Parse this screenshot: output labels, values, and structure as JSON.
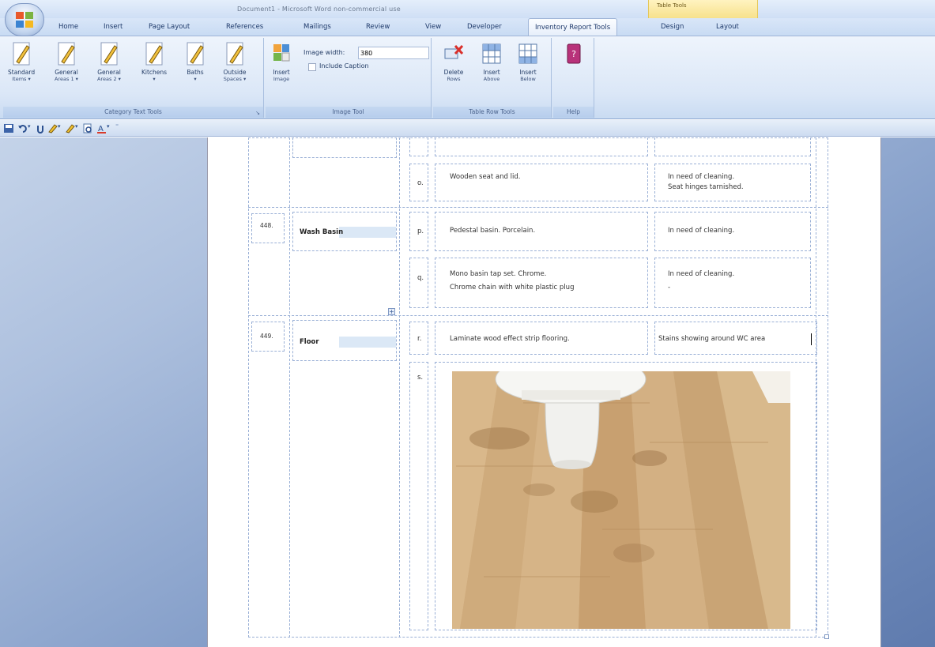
{
  "window": {
    "title": "Document1 - Microsoft Word non-commercial use",
    "context_tab_group": "Table Tools"
  },
  "tabs": [
    {
      "label": "Home"
    },
    {
      "label": "Insert"
    },
    {
      "label": "Page Layout"
    },
    {
      "label": "References"
    },
    {
      "label": "Mailings"
    },
    {
      "label": "Review"
    },
    {
      "label": "View"
    },
    {
      "label": "Developer"
    },
    {
      "label": "Inventory Report Tools"
    },
    {
      "label": "Design"
    },
    {
      "label": "Layout"
    }
  ],
  "ribbon": {
    "category_text_tools": {
      "label": "Category Text Tools",
      "buttons": [
        {
          "label": "Standard",
          "sub": "Items ▾"
        },
        {
          "label": "General",
          "sub": "Areas 1 ▾"
        },
        {
          "label": "General",
          "sub": "Areas 2 ▾"
        },
        {
          "label": "Kitchens",
          "sub": "▾"
        },
        {
          "label": "Baths",
          "sub": "▾"
        },
        {
          "label": "Outside",
          "sub": "Spaces ▾"
        }
      ]
    },
    "image_tool": {
      "label": "Image Tool",
      "insert_label": "Insert",
      "insert_sub": "Image",
      "width_label": "Image width:",
      "width_value": "380",
      "caption_label": "Include Caption"
    },
    "table_row_tools": {
      "label": "Table Row Tools",
      "buttons": [
        {
          "label": "Delete",
          "sub": "Rows"
        },
        {
          "label": "Insert",
          "sub": "Above"
        },
        {
          "label": "Insert",
          "sub": "Below"
        }
      ]
    },
    "help": {
      "label": "Help"
    }
  },
  "document": {
    "rows": [
      {
        "letter": "o.",
        "description": [
          "Wooden seat and lid."
        ],
        "condition": [
          "In need of cleaning.",
          "Seat hinges tarnished."
        ]
      },
      {
        "number": "448.",
        "name": "Wash Basin",
        "letter": "p.",
        "description": [
          "Pedestal basin. Porcelain."
        ],
        "condition": [
          "In need of cleaning."
        ]
      },
      {
        "letter": "q.",
        "description": [
          "Mono basin tap set.  Chrome.",
          "Chrome chain with white plastic plug"
        ],
        "condition": [
          "In need of cleaning.",
          "-"
        ]
      },
      {
        "number": "449.",
        "name": "Floor",
        "letter": "r.",
        "description": [
          "Laminate wood effect strip flooring."
        ],
        "condition": [
          "Stains showing around WC area"
        ]
      },
      {
        "letter": "s."
      }
    ]
  }
}
